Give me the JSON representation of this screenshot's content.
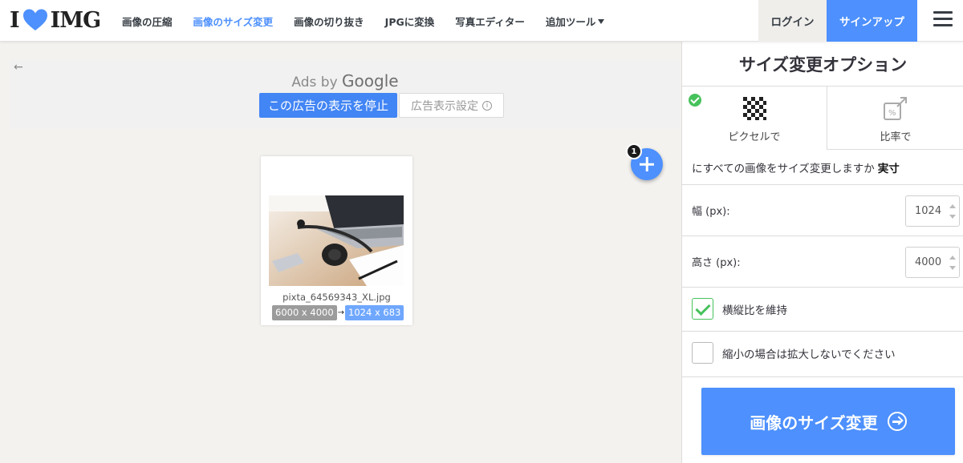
{
  "header": {
    "logo_left": "I",
    "logo_right": "IMG",
    "nav": [
      {
        "label": "画像の圧縮",
        "active": false
      },
      {
        "label": "画像のサイズ変更",
        "active": true
      },
      {
        "label": "画像の切り抜き",
        "active": false
      },
      {
        "label": "JPGに変換",
        "active": false
      },
      {
        "label": "写真エディター",
        "active": false
      },
      {
        "label": "追加ツール",
        "active": false,
        "dropdown": true
      }
    ],
    "login_label": "ログイン",
    "signup_label": "サインアップ",
    "menu_icon": "hamburger-menu-icon"
  },
  "ad": {
    "back_icon": "←",
    "ads_by": "Ads by",
    "google": "Google",
    "stop_label": "この広告の表示を停止",
    "settings_label": "広告表示設定",
    "info_icon": "ⓘ"
  },
  "files": {
    "count": "1",
    "items": [
      {
        "name": "pixta_64569343_XL.jpg",
        "original_size": "6000 x 4000",
        "arrow": "→",
        "new_size": "1024 x 683"
      }
    ]
  },
  "sidebar": {
    "title": "サイズ変更オプション",
    "mode_pixels_label": "ピクセルで",
    "mode_percent_label": "比率で",
    "question_text": "にすべての画像をサイズ変更しますか",
    "question_value": "実寸",
    "width_label": "幅 (px):",
    "width_value": "1024",
    "height_label": "高さ (px):",
    "height_value": "4000",
    "keep_ratio_label": "横縦比を維持",
    "keep_ratio_checked": true,
    "no_enlarge_label": "縮小の場合は拡大しないでください",
    "no_enlarge_checked": false,
    "submit_label": "画像のサイズ変更"
  },
  "colors": {
    "accent": "#4d90fe",
    "check_green": "#46c25b",
    "heart": "#4d90fe",
    "ad_blue": "#4285f4"
  }
}
